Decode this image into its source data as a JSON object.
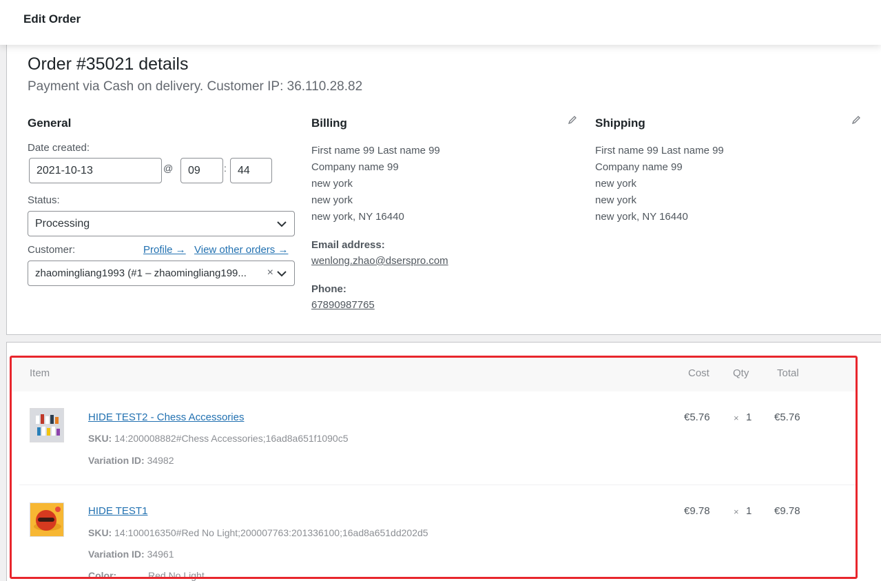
{
  "header": {
    "title": "Edit Order"
  },
  "order": {
    "heading": "Order #35021 details",
    "subtitle": "Payment via Cash on delivery. Customer IP: 36.110.28.82"
  },
  "general": {
    "title": "General",
    "date_label": "Date created:",
    "date_value": "2021-10-13",
    "at": "@",
    "hour": "09",
    "colon": ":",
    "minute": "44",
    "status_label": "Status:",
    "status_value": "Processing",
    "customer_label": "Customer:",
    "profile_link": "Profile →",
    "other_orders_link": "View other orders →",
    "customer_value": "zhaomingliang1993 (#1 – zhaomingliang199...",
    "clear_glyph": "×"
  },
  "billing": {
    "title": "Billing",
    "address_lines": [
      "First name 99 Last name 99",
      "Company name 99",
      "new york",
      "new york",
      "new york, NY 16440"
    ],
    "email_label": "Email address:",
    "email": "wenlong.zhao@dserspro.com",
    "phone_label": "Phone:",
    "phone": "67890987765"
  },
  "shipping": {
    "title": "Shipping",
    "address_lines": [
      "First name 99 Last name 99",
      "Company name 99",
      "new york",
      "new york",
      "new york, NY 16440"
    ]
  },
  "items_table": {
    "headers": {
      "item": "Item",
      "cost": "Cost",
      "qty": "Qty",
      "total": "Total"
    },
    "rows": [
      {
        "name": "HIDE TEST2 - Chess Accessories",
        "sku_label": "SKU:",
        "sku": "14:200008882#Chess Accessories;16ad8a651f1090c5",
        "variation_label": "Variation ID:",
        "variation": "34982",
        "cost": "€5.76",
        "qty_x": "×",
        "qty": "1",
        "total": "€5.76"
      },
      {
        "name": "HIDE TEST1",
        "sku_label": "SKU:",
        "sku": "14:100016350#Red No Light;200007763:201336100;16ad8a651dd202d5",
        "variation_label": "Variation ID:",
        "variation": "34961",
        "color_label": "Color:",
        "color": "Red No Light",
        "cost": "€9.78",
        "qty_x": "×",
        "qty": "1",
        "total": "€9.78"
      }
    ]
  },
  "colors": {
    "link": "#2271b1",
    "highlight_border": "#e8262d"
  },
  "icons": [
    "pencil-icon",
    "chevron-down-icon",
    "clear-icon"
  ]
}
